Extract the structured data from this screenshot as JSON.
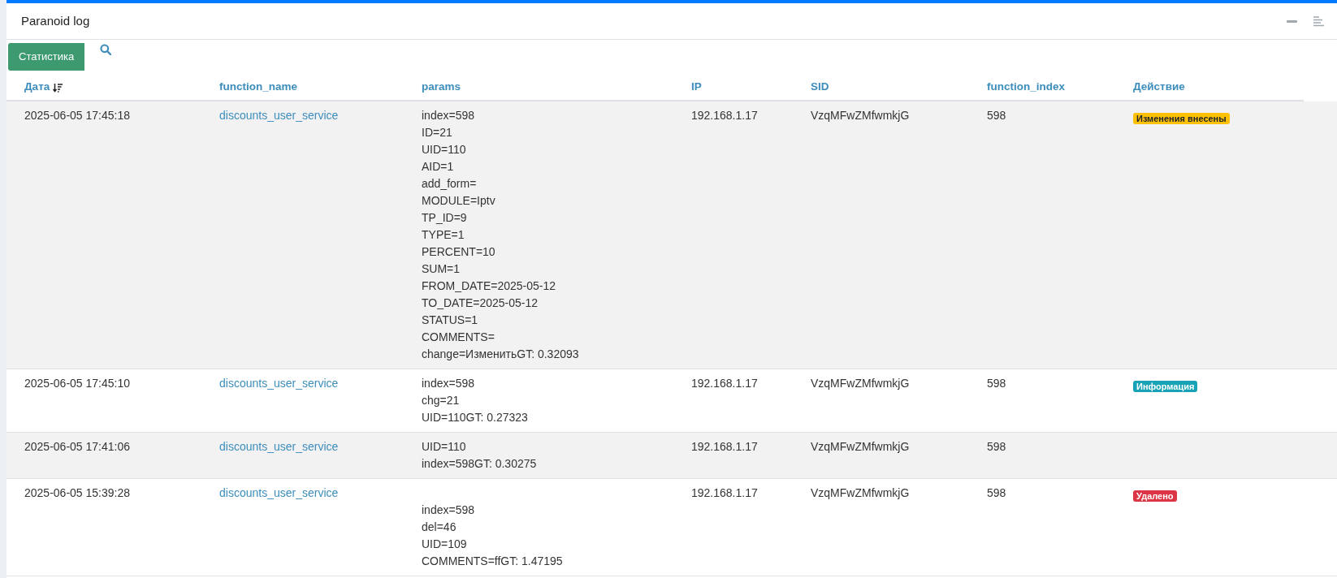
{
  "window": {
    "title": "Paranoid log"
  },
  "toolbar": {
    "button": "Статистика"
  },
  "table": {
    "columns": [
      {
        "label": "Дата",
        "sorted": true
      },
      {
        "label": "function_name",
        "sorted": false
      },
      {
        "label": "params",
        "sorted": false
      },
      {
        "label": "IP",
        "sorted": false
      },
      {
        "label": "SID",
        "sorted": false
      },
      {
        "label": "function_index",
        "sorted": false
      },
      {
        "label": "Действие",
        "sorted": false
      }
    ],
    "rows": [
      {
        "date": "2025-06-05 17:45:18",
        "function_name": "discounts_user_service",
        "leading_break": false,
        "params": [
          "index=598",
          "ID=21",
          "UID=110",
          "AID=1",
          "add_form=",
          "MODULE=Iptv",
          "TP_ID=9",
          "TYPE=1",
          "PERCENT=10",
          "SUM=1",
          "FROM_DATE=2025-05-12",
          "TO_DATE=2025-05-12",
          "STATUS=1",
          "COMMENTS=",
          "change=ИзменитьGT: 0.32093"
        ],
        "ip": "192.168.1.17",
        "sid": "VzqMFwZMfwmkjG",
        "function_index": "598",
        "action": {
          "label": "Изменения внесены",
          "kind": "warning"
        }
      },
      {
        "date": "2025-06-05 17:45:10",
        "function_name": "discounts_user_service",
        "leading_break": false,
        "params": [
          "index=598",
          "chg=21",
          "UID=110GT: 0.27323"
        ],
        "ip": "192.168.1.17",
        "sid": "VzqMFwZMfwmkjG",
        "function_index": "598",
        "action": {
          "label": "Информация",
          "kind": "info"
        }
      },
      {
        "date": "2025-06-05 17:41:06",
        "function_name": "discounts_user_service",
        "leading_break": false,
        "params": [
          "UID=110",
          "index=598GT: 0.30275"
        ],
        "ip": "192.168.1.17",
        "sid": "VzqMFwZMfwmkjG",
        "function_index": "598"
      },
      {
        "date": "2025-06-05 15:39:28",
        "function_name": "discounts_user_service",
        "leading_break": true,
        "params": [
          "index=598",
          "del=46",
          "UID=109",
          "COMMENTS=ffGT: 1.47195"
        ],
        "ip": "192.168.1.17",
        "sid": "VzqMFwZMfwmkjG",
        "function_index": "598",
        "action": {
          "label": "Удалено",
          "kind": "danger"
        }
      }
    ]
  }
}
